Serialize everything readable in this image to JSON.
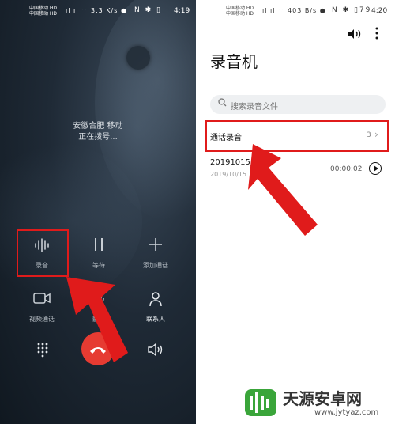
{
  "left_screen": {
    "status_bar": {
      "carrier_1": "中国移动 HD",
      "carrier_2": "中国移动 HD",
      "speed": "3.3 K/s",
      "time": "4:19"
    },
    "caller_location": "安徽合肥 移动",
    "call_status": "正在拨号...",
    "controls": {
      "record_label": "录音",
      "hold_label": "等待",
      "add_call_label": "添加通话",
      "video_call_label": "视频通话",
      "mute_label": "静音",
      "contacts_label": "联系人"
    }
  },
  "right_screen": {
    "status_bar": {
      "carrier_1": "中国移动 HD",
      "carrier_2": "中国移动 HD",
      "speed": "403 B/s",
      "battery": "79",
      "time": "4:20"
    },
    "app_title": "录音机",
    "search_placeholder": "搜索录音文件",
    "folder": {
      "name": "通话录音",
      "count": "3"
    },
    "recording": {
      "name": "20191015_0",
      "date": "2019/10/15",
      "duration": "00:00:02"
    }
  },
  "watermark": {
    "name": "天源安卓网",
    "url": "www.jytyaz.com"
  },
  "colors": {
    "annotation_red": "#e01b1b",
    "hangup_red": "#e63b32"
  },
  "icons": [
    "waveform-icon",
    "pause-icon",
    "plus-icon",
    "video-camera-icon",
    "microphone-icon",
    "person-icon",
    "dialpad-icon",
    "phone-hangup-icon",
    "speaker-icon",
    "volume-icon",
    "more-icon",
    "search-icon",
    "chevron-right-icon",
    "play-icon"
  ]
}
